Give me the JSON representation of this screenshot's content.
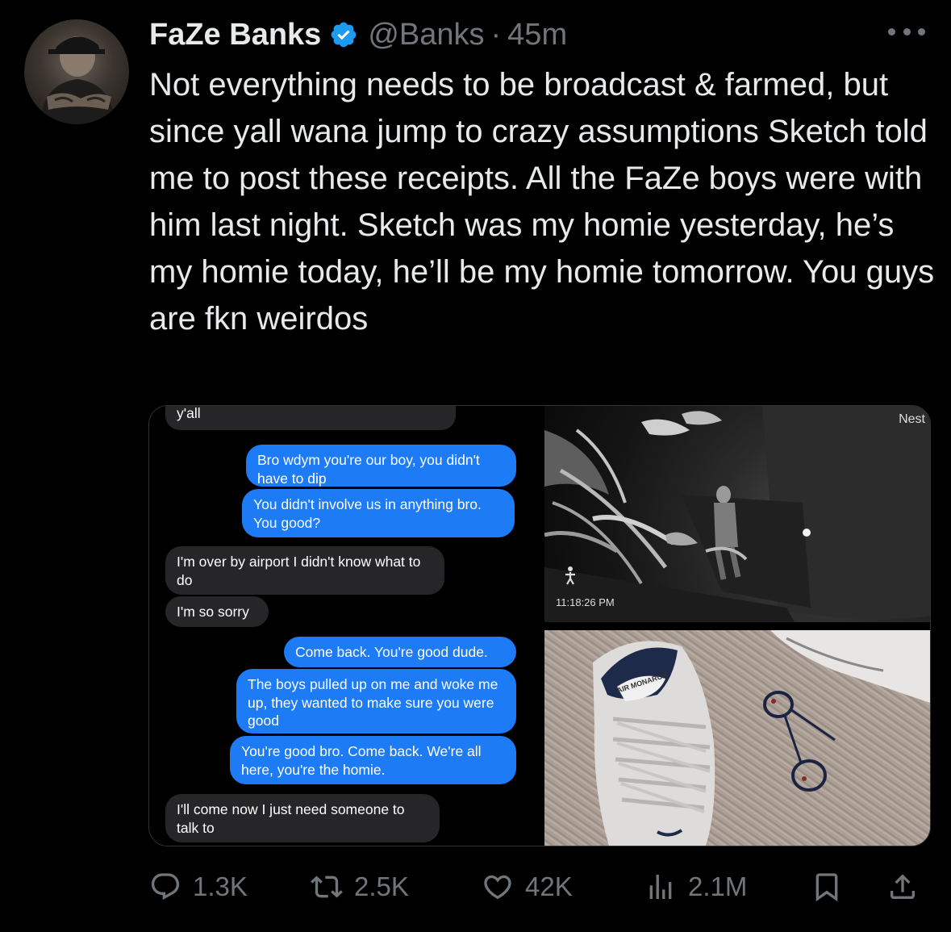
{
  "post": {
    "author_name": "FaZe Banks",
    "handle": "@Banks",
    "separator": "·",
    "time": "45m",
    "text": "Not everything needs to be broadcast & farmed, but since yall wana jump to crazy assumptions Sketch told me to post these receipts. All the FaZe boys were with him last night. Sketch was my homie yesterday, he’s my homie today, he’ll be my homie tomorrow. You guys are fkn weirdos"
  },
  "chat": {
    "messages": [
      {
        "side": "in",
        "text": "y'all"
      },
      {
        "side": "out",
        "text": "Bro wdym you're our boy, you didn't have to dip"
      },
      {
        "side": "out",
        "text": "You didn't involve us in anything bro. You good?"
      },
      {
        "side": "in",
        "text": "I'm over by airport I didn't know what to do"
      },
      {
        "side": "in",
        "text": "I'm so sorry"
      },
      {
        "side": "out",
        "text": "Come back. You're good dude."
      },
      {
        "side": "out",
        "text": "The boys pulled up on me and woke me up, they wanted to make sure you were good"
      },
      {
        "side": "out",
        "text": "You're good bro. Come back. We're all here, you're the homie."
      },
      {
        "side": "in",
        "text": "I'll come now I just need someone to talk to"
      }
    ]
  },
  "camera": {
    "brand": "Nest",
    "timestamp": "11:18:26 PM"
  },
  "shoe_photo": {
    "shoe_label": "AIR MONARCH"
  },
  "actions": {
    "replies": "1.3K",
    "reposts": "2.5K",
    "likes": "42K",
    "views": "2.1M"
  },
  "colors": {
    "background": "#000000",
    "text": "#e7e9ea",
    "muted": "#71767b",
    "verified": "#1d9bf0",
    "imessage_blue": "#1d7bf5",
    "imessage_gray": "#262628"
  },
  "icons": [
    "more-icon",
    "verified-badge-icon",
    "reply-icon",
    "repost-icon",
    "like-icon",
    "views-icon",
    "bookmark-icon",
    "share-icon"
  ]
}
